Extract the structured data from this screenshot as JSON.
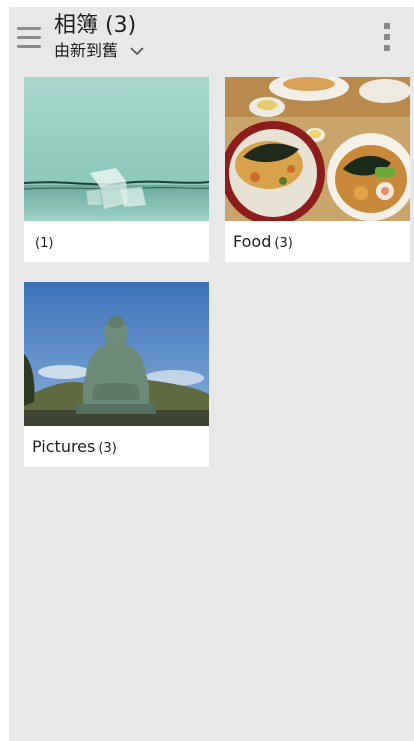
{
  "appbar": {
    "title": "相簿 (3)",
    "sort_label": "由新到舊"
  },
  "albums": [
    {
      "name": "",
      "count": "(1)"
    },
    {
      "name": "Food",
      "count": "(3)"
    },
    {
      "name": "Pictures",
      "count": "(3)"
    }
  ],
  "colors": {
    "background": "#e8e8e8",
    "card": "#ffffff",
    "icon": "#8a8a8a",
    "text": "#1e1e1e"
  },
  "icons": {
    "menu": "hamburger-menu-icon",
    "sort": "chevron-down-icon",
    "more": "more-vertical-icon"
  }
}
